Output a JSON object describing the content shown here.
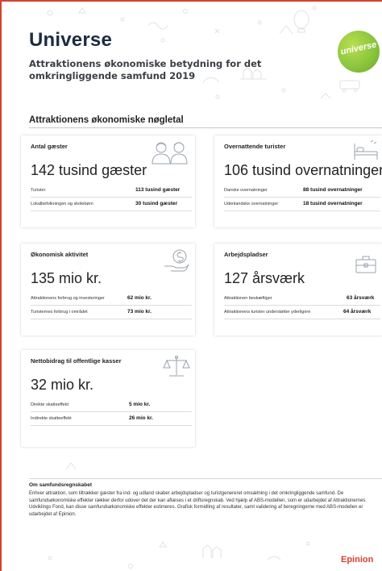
{
  "header": {
    "title": "Universe",
    "subtitle": "Attraktionens økonomiske betydning for det omkringliggende samfund 2019",
    "logo_text": "universe",
    "logo_color": "#8cc63e"
  },
  "section_title": "Attraktionens økonomiske nøgletal",
  "cards": [
    {
      "title": "Antal gæster",
      "big": "142 tusind gæster",
      "icon": "people-icon",
      "rows": [
        {
          "label": "Turister",
          "value": "113 tusind gæster"
        },
        {
          "label": "Lokalbefolkningen og skolebørn",
          "value": "30 tusind gæster"
        }
      ]
    },
    {
      "title": "Overnattende turister",
      "big": "106 tusind overnatninger",
      "icon": "bed-icon",
      "rows": [
        {
          "label": "Danske overnatninger",
          "value": "88 tusind overnatninger"
        },
        {
          "label": "Udenlandske overnatninger",
          "value": "18 tusind overnatninger"
        }
      ]
    },
    {
      "title": "Økonomisk aktivitet",
      "big": "135 mio kr.",
      "icon": "money-hand-icon",
      "rows": [
        {
          "label": "Attraktionens forbrug og investeringer",
          "value": "62 mio kr."
        },
        {
          "label": "Turisternes forbrug i området",
          "value": "73 mio kr."
        }
      ]
    },
    {
      "title": "Arbejdspladser",
      "big": "127 årsværk",
      "icon": "briefcase-icon",
      "rows": [
        {
          "label": "Attraktionen beskæftiger",
          "value": "63 årsværk"
        },
        {
          "label": "Attraktionens turister understøtter yderligere",
          "value": "64 årsværk"
        }
      ]
    },
    {
      "title": "Nettobidrag til offentlige kasser",
      "big": "32 mio kr.",
      "icon": "scales-icon",
      "rows": [
        {
          "label": "Direkte skatteeffekt",
          "value": "5 mio kr."
        },
        {
          "label": "Indirekte skatteeffekt",
          "value": "26 mio kr."
        }
      ]
    }
  ],
  "about": {
    "title": "Om samfundsregnskabet",
    "text": "Enhver attraktion, som tiltrækker gæster fra ind- og udland skaber arbejdspladser og turistgenereret omsætning i det omkringliggende samfund. De samfundsøkonomiske effekter rækker derfor udover det der kan aflæses i et driftsregnskab. Ved hjælp af ABS-modellen, som er udarbejdet af Attraktionernes Udviklings Fond, kan disse samfundsøkonomiske effekter estimeres. Grafisk formidling af resultater, samt validering af beregningerne med ABS-modellen er udarbejdet af Epinion."
  },
  "footer": {
    "brand": "Epinion",
    "brand_color": "#d6402f"
  }
}
